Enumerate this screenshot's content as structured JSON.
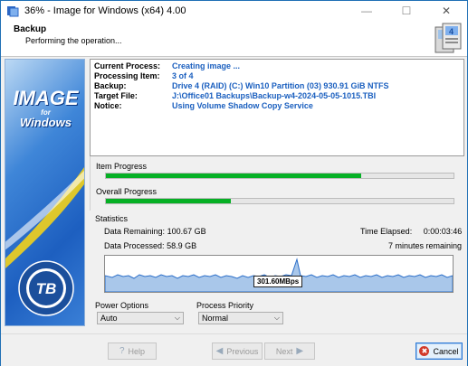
{
  "window": {
    "title": "36% - Image for Windows (x64) 4.00",
    "min_glyph": "—",
    "max_glyph": "☐",
    "close_glyph": "✕"
  },
  "header": {
    "title": "Backup",
    "subtitle": "Performing the operation..."
  },
  "banner": {
    "image": "IMAGE",
    "for": "for",
    "windows": "Windows"
  },
  "info": [
    {
      "label": "Current Process:",
      "value": "Creating image ..."
    },
    {
      "label": "Processing Item:",
      "value": "3 of 4"
    },
    {
      "label": "Backup:",
      "value": "Drive 4 (RAID) (C:) Win10 Partition (03) 930.91 GiB NTFS"
    },
    {
      "label": "Target File:",
      "value": "J:\\Office01 Backups\\Backup-w4-2024-05-05-1015.TBI"
    },
    {
      "label": "Notice:",
      "value": "Using Volume Shadow Copy Service"
    }
  ],
  "progress": {
    "item_label": "Item Progress",
    "item_fraction": 0.735,
    "overall_label": "Overall Progress",
    "overall_fraction": 0.36
  },
  "stats": {
    "title": "Statistics",
    "remaining_label": "Data Remaining:",
    "remaining_value": "100.67 GB",
    "processed_label": "Data Processed:",
    "processed_value": "58.9 GB",
    "elapsed_label": "Time Elapsed:",
    "elapsed_value": "0:00:03:46",
    "time_remaining": "7 minutes remaining",
    "speed": "301.60MBps"
  },
  "options": {
    "power_label": "Power Options",
    "power_value": "Auto",
    "priority_label": "Process Priority",
    "priority_value": "Normal"
  },
  "footer": {
    "help": "Help",
    "previous": "Previous",
    "next": "Next",
    "cancel": "Cancel"
  },
  "colors": {
    "progress_fill": "#06b025",
    "info_value": "#1a5fbf",
    "graph_fill": "#a9c7ea",
    "graph_line": "#2c6fc9"
  }
}
